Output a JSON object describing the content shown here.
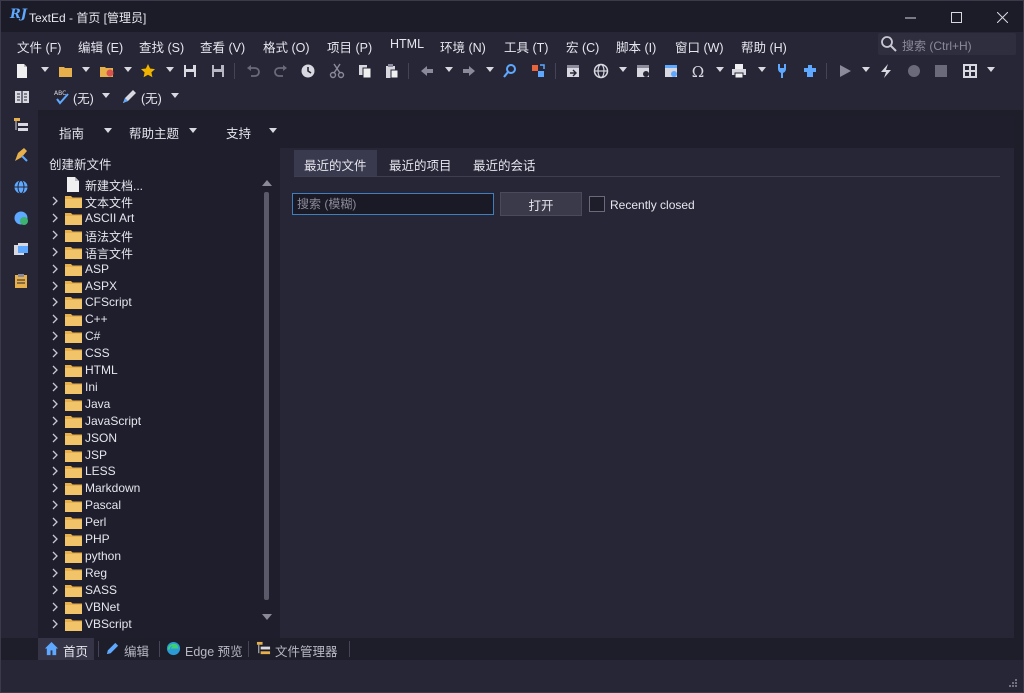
{
  "window": {
    "title": "TextEd - 首页 [管理员]",
    "logo_text": "RJ"
  },
  "menu": [
    "文件 (F)",
    "编辑 (E)",
    "查找 (S)",
    "查看 (V)",
    "格式 (O)",
    "项目 (P)",
    "HTML",
    "环境 (N)",
    "工具 (T)",
    "宏 (C)",
    "脚本 (I)",
    "窗口 (W)",
    "帮助 (H)"
  ],
  "search": {
    "placeholder": "搜索 (Ctrl+H)"
  },
  "toolbar2": {
    "spell_value": "(无)",
    "highlight_value": "(无)"
  },
  "subnav": {
    "guide": "指南",
    "help_topics": "帮助主题",
    "support": "支持"
  },
  "tree": {
    "title": "创建新文件",
    "new_doc": "新建文档...",
    "folders": [
      "文本文件",
      "ASCII Art",
      "语法文件",
      "语言文件",
      "ASP",
      "ASPX",
      "CFScript",
      "C++",
      "C#",
      "CSS",
      "HTML",
      "Ini",
      "Java",
      "JavaScript",
      "JSON",
      "JSP",
      "LESS",
      "Markdown",
      "Pascal",
      "Perl",
      "PHP",
      "python",
      "Reg",
      "SASS",
      "VBNet",
      "VBScript"
    ]
  },
  "tabs": [
    "最近的文件",
    "最近的项目",
    "最近的会话"
  ],
  "recent": {
    "search_placeholder": "搜索 (模糊)",
    "open_label": "打开",
    "recently_closed_label": "Recently closed"
  },
  "bottom_tabs": [
    "首页",
    "编辑",
    "Edge 预览",
    "文件管理器"
  ],
  "colors": {
    "accent": "#3f7fbf",
    "folder": "#e8b04a",
    "background": "#1e1e2a"
  }
}
